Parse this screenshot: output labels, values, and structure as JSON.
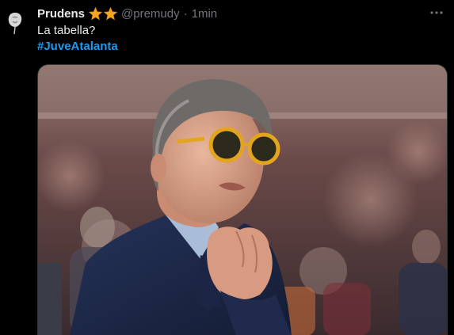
{
  "tweet": {
    "display_name": "Prudens",
    "handle": "@premudy",
    "separator": "·",
    "time": "1min",
    "text": "La tabella?",
    "hashtag": "#JuveAtalanta",
    "more_icon": "more-icon"
  },
  "colors": {
    "background": "#000000",
    "text": "#e7e9ea",
    "muted": "#71767b",
    "link": "#1d9bf0",
    "star": "#f5a623"
  },
  "media": {
    "type": "photo",
    "icon": "photo"
  }
}
